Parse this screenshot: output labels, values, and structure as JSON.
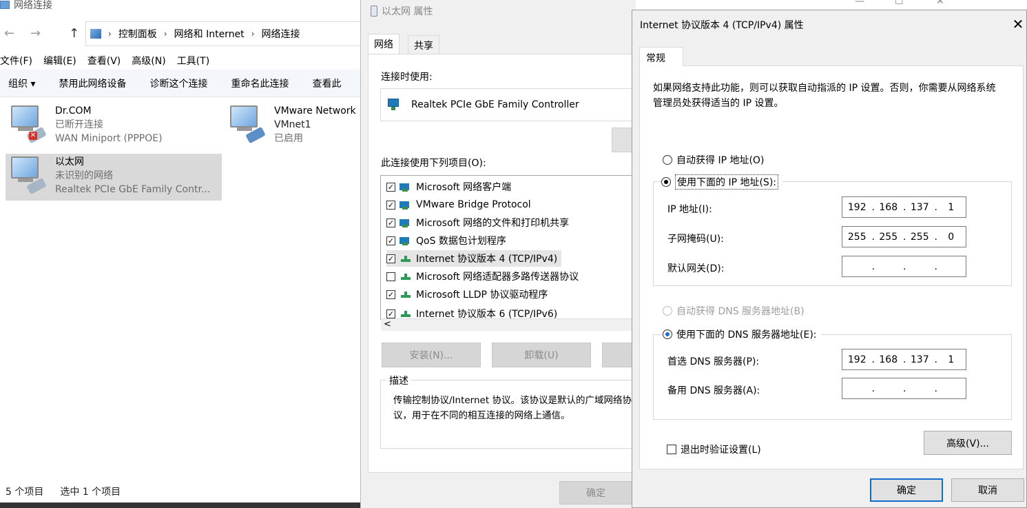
{
  "explorer": {
    "title": "网络连接",
    "breadcrumb": [
      "控制面板",
      "网络和 Internet",
      "网络连接"
    ],
    "menu": [
      "文件(F)",
      "编辑(E)",
      "查看(V)",
      "高级(N)",
      "工具(T)"
    ],
    "commands": [
      "组织 ▾",
      "禁用此网络设备",
      "诊断这个连接",
      "重命名此连接",
      "查看此"
    ],
    "connections": [
      {
        "name": "Dr.COM",
        "status": "已断开连接",
        "device": "WAN Miniport (PPPOE)"
      },
      {
        "name": "VMware Network",
        "status": "VMnet1",
        "device": "已启用"
      },
      {
        "name": "以太网",
        "status": "未识别的网络",
        "device": "Realtek PCIe GbE Family Contr..."
      }
    ],
    "status_count": "5 个项目",
    "status_selected": "选中 1 个项目"
  },
  "ethernet": {
    "title": "以太网 属性",
    "tabs": [
      "网络",
      "共享"
    ],
    "connect_using_label": "连接时使用:",
    "adapter": "Realtek PCIe GbE Family Controller",
    "items_label": "此连接使用下列项目(O):",
    "items": [
      {
        "label": "Microsoft 网络客户端",
        "checked": true
      },
      {
        "label": "VMware Bridge Protocol",
        "checked": true
      },
      {
        "label": "Microsoft 网络的文件和打印机共享",
        "checked": true
      },
      {
        "label": "QoS 数据包计划程序",
        "checked": true
      },
      {
        "label": "Internet 协议版本 4 (TCP/IPv4)",
        "checked": true
      },
      {
        "label": "Microsoft 网络适配器多路传送器协议",
        "checked": false
      },
      {
        "label": "Microsoft LLDP 协议驱动程序",
        "checked": true
      },
      {
        "label": "Internet 协议版本 6 (TCP/IPv6)",
        "checked": true
      }
    ],
    "scroll_left": "<",
    "install": "安装(N)...",
    "uninstall": "卸载(U)",
    "desc_label": "描述",
    "description": "传输控制协议/Internet 协议。该协议是默认的广域网络协议，用于在不同的相互连接的网络上通信。",
    "ok": "确定"
  },
  "background_controls": {
    "minimize": "—",
    "maximize": "☐",
    "close": "✕"
  },
  "ipv4": {
    "title": "Internet 协议版本 4 (TCP/IPv4) 属性",
    "close": "✕",
    "tab": "常规",
    "intro": "如果网络支持此功能，则可以获取自动指派的 IP 设置。否则，你需要从网络系统管理员处获得适当的 IP 设置。",
    "auto_ip": "自动获得 IP 地址(O)",
    "manual_ip": "使用下面的 IP 地址(S):",
    "ip_label": "IP 地址(I):",
    "ip": [
      "192",
      "168",
      "137",
      "1"
    ],
    "mask_label": "子网掩码(U):",
    "mask": [
      "255",
      "255",
      "255",
      "0"
    ],
    "gateway_label": "默认网关(D):",
    "gateway": [
      "",
      "",
      "",
      ""
    ],
    "auto_dns": "自动获得 DNS 服务器地址(B)",
    "manual_dns": "使用下面的 DNS 服务器地址(E):",
    "dns1_label": "首选 DNS 服务器(P):",
    "dns1": [
      "192",
      "168",
      "137",
      "1"
    ],
    "dns2_label": "备用 DNS 服务器(A):",
    "dns2": [
      "",
      "",
      "",
      ""
    ],
    "validate": "退出时验证设置(L)",
    "advanced": "高级(V)...",
    "ok": "确定",
    "cancel": "取消"
  }
}
